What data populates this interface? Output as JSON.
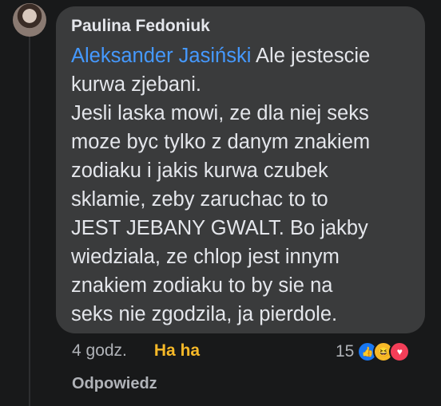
{
  "comment": {
    "author": "Paulina Fedoniuk",
    "mention": "Aleksander Jasiński",
    "text": " Ale jestescie\nkurwa zjebani.\nJesli laska mowi, ze dla niej seks\nmoze byc tylko z danym znakiem\nzodiaku i jakis kurwa czubek\nsklamie, zeby zaruchac to to\nJEST JEBANY GWALT. Bo jakby\nwiedziala, ze chlop jest innym\nznakiem zodiaku to by sie na\nseks nie zgodzila, ja pierdole.",
    "time": "4 godz.",
    "reaction_label": "Ha ha",
    "reaction_count": "15",
    "reaction_icons": [
      "like-icon",
      "haha-icon",
      "love-icon"
    ],
    "reply_label": "Odpowiedz"
  },
  "colors": {
    "background": "#18191a",
    "bubble": "#3a3b3c",
    "mention": "#4599ff",
    "haha": "#f7b928"
  }
}
